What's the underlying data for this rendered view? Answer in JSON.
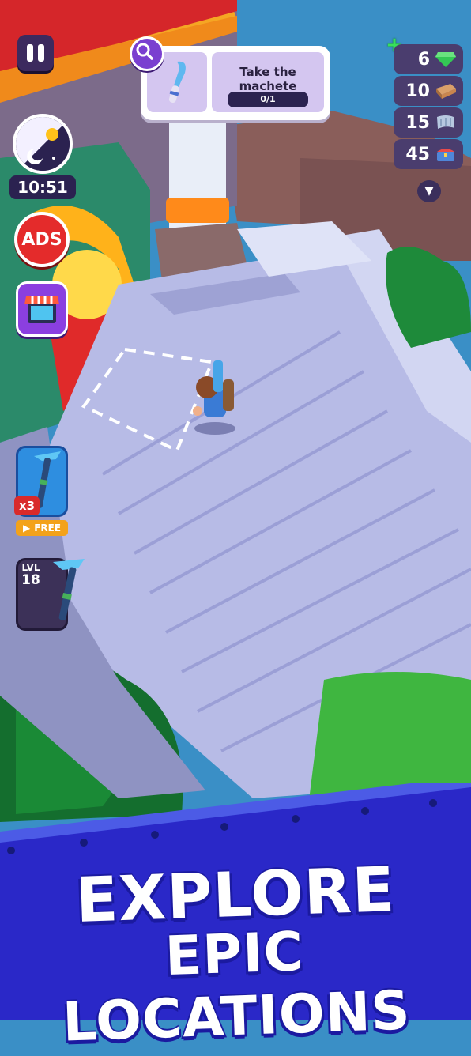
{
  "hud": {
    "time": "10:51",
    "ads_label": "ADS"
  },
  "quest": {
    "title": "Take the machete",
    "progress": "0/1"
  },
  "resources": [
    {
      "value": "6",
      "icon": "gem-icon",
      "color": "#34c955"
    },
    {
      "value": "10",
      "icon": "wood-plank-icon",
      "color": "#c98a55"
    },
    {
      "value": "15",
      "icon": "cloth-icon",
      "color": "#9db4cf"
    },
    {
      "value": "45",
      "icon": "chest-icon",
      "color": "#4f86d8"
    }
  ],
  "tools": {
    "free_multiplier": "x3",
    "free_label": "FREE",
    "level_label": "LVL",
    "level_value": "18"
  },
  "banner": {
    "line1": "EXPLORE",
    "line2": "EPIC LOCATIONS"
  }
}
